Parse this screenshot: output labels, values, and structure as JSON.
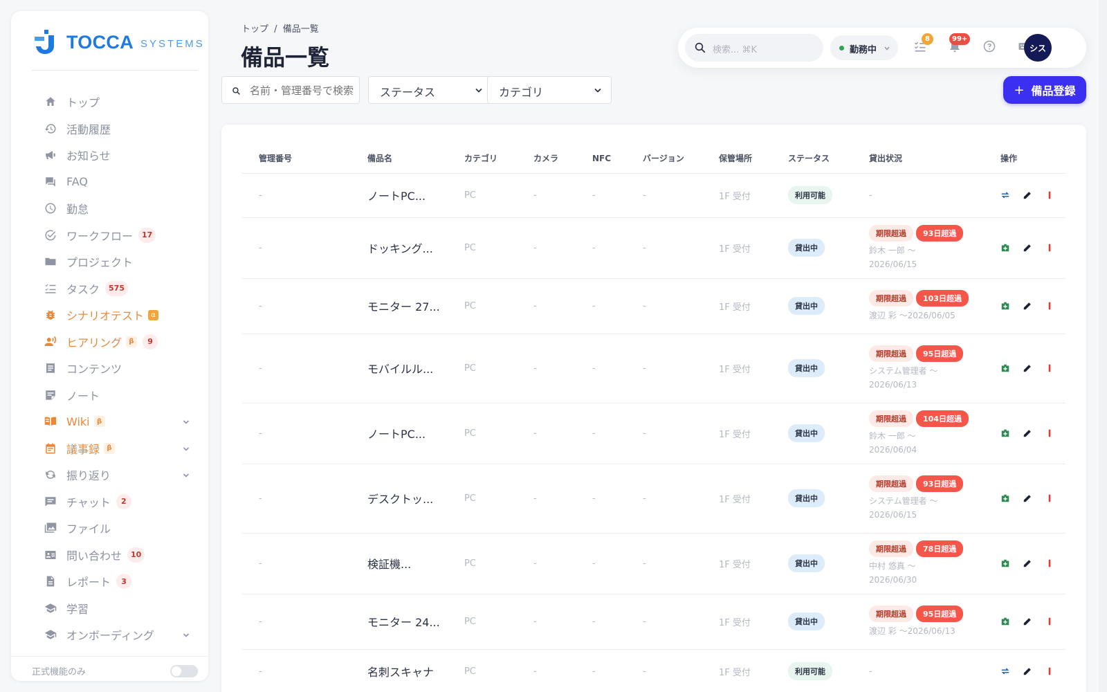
{
  "sidebar": {
    "logo": {
      "name": "TOCCA",
      "sub": "SYSTEMS"
    },
    "items": [
      {
        "label": "トップ",
        "icon": "home-icon"
      },
      {
        "label": "活動履歴",
        "icon": "history-icon"
      },
      {
        "label": "お知らせ",
        "icon": "megaphone-icon"
      },
      {
        "label": "FAQ",
        "icon": "forum-icon"
      },
      {
        "label": "勤怠",
        "icon": "clock-icon"
      },
      {
        "label": "ワークフロー",
        "icon": "check-circle-icon",
        "count": "17"
      },
      {
        "label": "プロジェクト",
        "icon": "folder-icon"
      },
      {
        "label": "タスク",
        "icon": "checklist-icon",
        "count": "575"
      },
      {
        "label": "シナリオテスト",
        "icon": "bug-icon",
        "tag": "α",
        "highlight": true
      },
      {
        "label": "ヒアリング",
        "icon": "voice-icon",
        "tag": "β",
        "count": "9",
        "highlight": true
      },
      {
        "label": "コンテンツ",
        "icon": "article-icon"
      },
      {
        "label": "ノート",
        "icon": "note-icon"
      },
      {
        "label": "Wiki",
        "icon": "book-icon",
        "tag": "β",
        "highlight": true,
        "expand": true
      },
      {
        "label": "議事録",
        "icon": "calendar-icon",
        "tag": "β",
        "highlight": true,
        "expand": true
      },
      {
        "label": "振り返り",
        "icon": "refresh-icon",
        "expand": true
      },
      {
        "label": "チャット",
        "icon": "chat-icon",
        "count": "2"
      },
      {
        "label": "ファイル",
        "icon": "image-icon"
      },
      {
        "label": "問い合わせ",
        "icon": "contact-card-icon",
        "count": "10"
      },
      {
        "label": "レポート",
        "icon": "report-icon",
        "count": "3"
      },
      {
        "label": "学習",
        "icon": "school-icon"
      },
      {
        "label": "オンボーディング",
        "icon": "onboarding-icon",
        "expand": true
      }
    ],
    "footer_label": "正式機能のみ"
  },
  "breadcrumb": {
    "top": "トップ",
    "sep": "/",
    "current": "備品一覧"
  },
  "page_title": "備品一覧",
  "filters": {
    "search_placeholder": "名前・管理番号で検索",
    "status_label": "ステータス",
    "category_label": "カテゴリ"
  },
  "add_button": {
    "plus": "+",
    "label": "備品登録"
  },
  "topbar": {
    "search_placeholder": "検索... ⌘K",
    "status": "勤務中",
    "task_badge": "8",
    "notify_badge": "99+",
    "avatar": "シス"
  },
  "colors": {
    "primary": "#3b2ff0",
    "accent": "#e8893a",
    "overdue": "#f4564a",
    "logo": "#1f7ae0"
  },
  "table": {
    "headers": [
      "管理番号",
      "備品名",
      "カテゴリ",
      "カメラ",
      "NFC",
      "バージョン",
      "保管場所",
      "ステータス",
      "貸出状況",
      "操作"
    ],
    "rows": [
      {
        "id": "-",
        "name": "ノートPC...",
        "category": "PC",
        "camera": "-",
        "nfc": "-",
        "version": "-",
        "location": "1F 受付",
        "status": "利用可能",
        "lend": null
      },
      {
        "id": "-",
        "name": "ドッキング...",
        "category": "PC",
        "camera": "-",
        "nfc": "-",
        "version": "-",
        "location": "1F 受付",
        "status": "貸出中",
        "lend": {
          "badge": "期限超過",
          "over": "93日超過",
          "who": "鈴木 一郎 〜2026/06/15"
        }
      },
      {
        "id": "-",
        "name": "モニター 27...",
        "category": "PC",
        "camera": "-",
        "nfc": "-",
        "version": "-",
        "location": "1F 受付",
        "status": "貸出中",
        "lend": {
          "badge": "期限超過",
          "over": "103日超過",
          "who": "渡辺 彩 〜2026/06/05"
        }
      },
      {
        "id": "-",
        "name": "モバイルル...",
        "category": "PC",
        "camera": "-",
        "nfc": "-",
        "version": "-",
        "location": "1F 受付",
        "status": "貸出中",
        "lend": {
          "badge": "期限超過",
          "over": "95日超過",
          "who": "システム管理者 〜2026/06/13"
        }
      },
      {
        "id": "-",
        "name": "ノートPC...",
        "category": "PC",
        "camera": "-",
        "nfc": "-",
        "version": "-",
        "location": "1F 受付",
        "status": "貸出中",
        "lend": {
          "badge": "期限超過",
          "over": "104日超過",
          "who": "鈴木 一郎 〜2026/06/04"
        }
      },
      {
        "id": "-",
        "name": "デスクトッ...",
        "category": "PC",
        "camera": "-",
        "nfc": "-",
        "version": "-",
        "location": "1F 受付",
        "status": "貸出中",
        "lend": {
          "badge": "期限超過",
          "over": "93日超過",
          "who": "システム管理者 〜2026/06/15"
        }
      },
      {
        "id": "-",
        "name": "検証機...",
        "category": "PC",
        "camera": "-",
        "nfc": "-",
        "version": "-",
        "location": "1F 受付",
        "status": "貸出中",
        "lend": {
          "badge": "期限超過",
          "over": "78日超過",
          "who": "中村 悠真 〜2026/06/30"
        }
      },
      {
        "id": "-",
        "name": "モニター 24...",
        "category": "PC",
        "camera": "-",
        "nfc": "-",
        "version": "-",
        "location": "1F 受付",
        "status": "貸出中",
        "lend": {
          "badge": "期限超過",
          "over": "95日超過",
          "who": "渡辺 彩 〜2026/06/13"
        }
      },
      {
        "id": "-",
        "name": "名刺スキャナ",
        "category": "PC",
        "camera": "-",
        "nfc": "-",
        "version": "-",
        "location": "1F 受付",
        "status": "利用可能",
        "lend": null
      }
    ]
  }
}
